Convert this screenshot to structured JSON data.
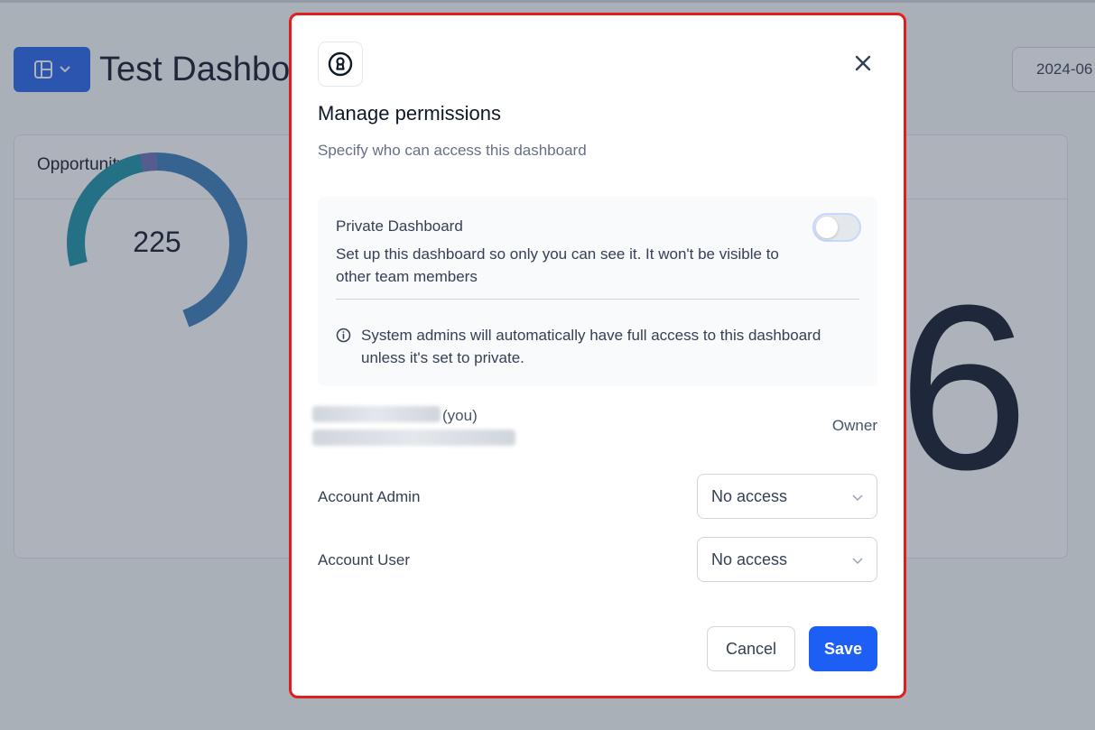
{
  "background": {
    "dashboard_title": "Test Dashboard",
    "date_value": "2024-06",
    "card_title": "Opportunity Status",
    "donut_total": "225",
    "big_number": "6"
  },
  "modal": {
    "title": "Manage permissions",
    "subtitle": "Specify who can access this dashboard",
    "private": {
      "title": "Private Dashboard",
      "description": "Set up this dashboard so only you can see it. It won't be visible to other team members",
      "enabled": false,
      "info": "System admins will automatically have full access to this dashboard unless it's set to private."
    },
    "owner": {
      "you_label": "(you)",
      "role": "Owner"
    },
    "roles": [
      {
        "label": "Account Admin",
        "access": "No access"
      },
      {
        "label": "Account User",
        "access": "No access"
      }
    ],
    "cancel_label": "Cancel",
    "save_label": "Save"
  },
  "colors": {
    "primary": "#1d5ff5",
    "highlight_border": "#e11d1d",
    "donut_teal": "#1a8fa6",
    "donut_blue": "#3a7ab8",
    "donut_purple": "#6a6fb8"
  },
  "icons": {
    "feature": "keyhole-lock-icon",
    "close": "close-icon",
    "info": "info-icon",
    "chevron": "chevron-down-icon",
    "layout": "layout-icon"
  }
}
